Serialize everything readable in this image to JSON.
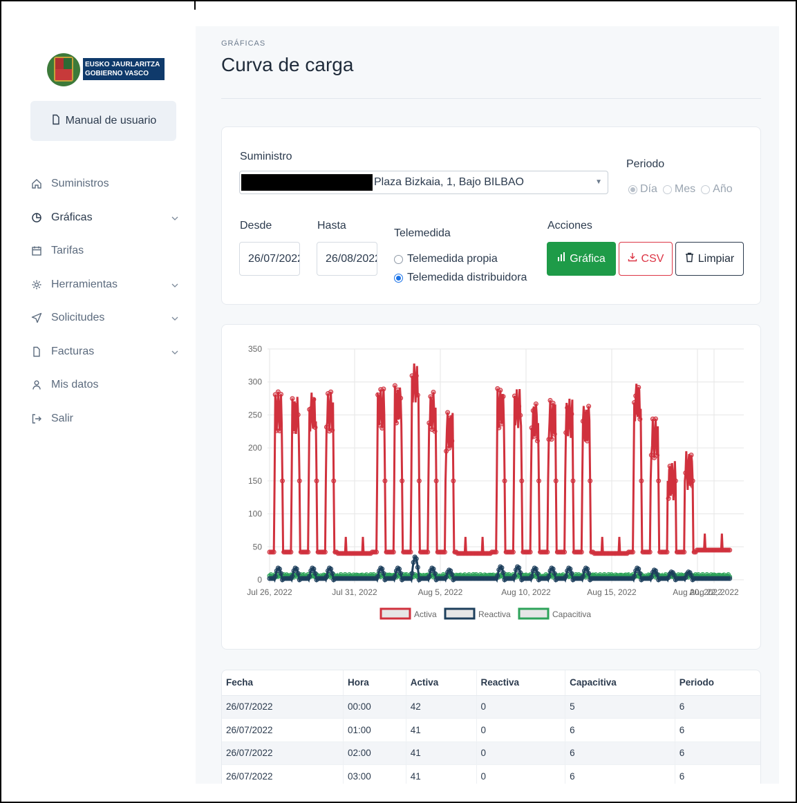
{
  "logo": {
    "line1": "EUSKO JAURLARITZA",
    "line2": "GOBIERNO VASCO"
  },
  "sidebar": {
    "manual_label": "Manual de usuario",
    "items": [
      {
        "label": "Suministros",
        "icon": "home-icon",
        "chevron": false
      },
      {
        "label": "Gráficas",
        "icon": "pie-chart-icon",
        "chevron": true
      },
      {
        "label": "Tarifas",
        "icon": "calendar-icon",
        "chevron": false
      },
      {
        "label": "Herramientas",
        "icon": "gear-icon",
        "chevron": true
      },
      {
        "label": "Solicitudes",
        "icon": "send-icon",
        "chevron": true
      },
      {
        "label": "Facturas",
        "icon": "file-icon",
        "chevron": true
      },
      {
        "label": "Mis datos",
        "icon": "user-icon",
        "chevron": false
      },
      {
        "label": "Salir",
        "icon": "logout-icon",
        "chevron": false
      }
    ]
  },
  "header": {
    "eyebrow": "GRÁFICAS",
    "title": "Curva de carga"
  },
  "form": {
    "suministro_label": "Suministro",
    "suministro_value": "Plaza Bizkaia, 1, Bajo BILBAO",
    "periodo_label": "Periodo",
    "periodo_options": [
      "Día",
      "Mes",
      "Año"
    ],
    "periodo_selected": "Día",
    "desde_label": "Desde",
    "desde_value": "26/07/2022",
    "hasta_label": "Hasta",
    "hasta_value": "26/08/2022",
    "telemedida_label": "Telemedida",
    "telemedida_options": [
      "Telemedida propia",
      "Telemedida distribuidora"
    ],
    "telemedida_selected": "Telemedida distribuidora",
    "acciones_label": "Acciones",
    "btn_grafica": "Gráfica",
    "btn_csv": "CSV",
    "btn_limpiar": "Limpiar"
  },
  "colors": {
    "activa": "#d0313d",
    "reactiva": "#1d3f5c",
    "capacitiva": "#2ea35a",
    "accent": "#1e9b48"
  },
  "chart_data": {
    "type": "line",
    "x_ticks": [
      "Jul 26, 2022",
      "Jul 31, 2022",
      "Aug 5, 2022",
      "Aug 10, 2022",
      "Aug 15, 2022",
      "Aug 20, 2022",
      "Aug 22, 2022"
    ],
    "y_ticks": [
      0,
      50,
      100,
      150,
      200,
      250,
      300,
      350
    ],
    "ylim": [
      0,
      350
    ],
    "grid": true,
    "legend": "bottom",
    "series": [
      {
        "name": "Activa",
        "daily_peaks": [
          285,
          278,
          285,
          285,
          40,
          40,
          290,
          295,
          328,
          285,
          255,
          40,
          40,
          290,
          290,
          270,
          272,
          275,
          265,
          40,
          40,
          300,
          245,
          180,
          195,
          45,
          45
        ]
      },
      {
        "name": "Reactiva",
        "daily_peaks": [
          18,
          18,
          18,
          18,
          3,
          3,
          18,
          18,
          35,
          18,
          15,
          3,
          3,
          20,
          20,
          18,
          18,
          18,
          18,
          3,
          3,
          18,
          15,
          12,
          12,
          3,
          3
        ]
      },
      {
        "name": "Capacitiva",
        "typical_value": 6
      }
    ]
  },
  "table": {
    "headers": [
      "Fecha",
      "Hora",
      "Activa",
      "Reactiva",
      "Capacitiva",
      "Periodo"
    ],
    "rows": [
      [
        "26/07/2022",
        "00:00",
        "42",
        "0",
        "5",
        "6"
      ],
      [
        "26/07/2022",
        "01:00",
        "41",
        "0",
        "6",
        "6"
      ],
      [
        "26/07/2022",
        "02:00",
        "41",
        "0",
        "6",
        "6"
      ],
      [
        "26/07/2022",
        "03:00",
        "41",
        "0",
        "6",
        "6"
      ]
    ]
  }
}
